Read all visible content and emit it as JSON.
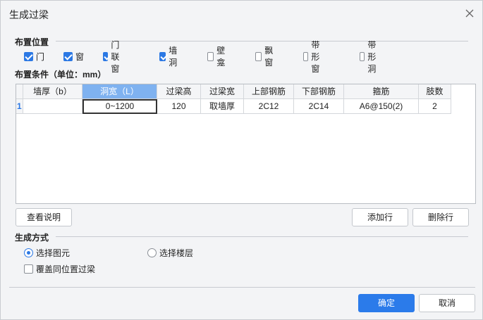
{
  "window": {
    "title": "生成过梁"
  },
  "placement": {
    "label": "布置位置",
    "options": [
      {
        "label": "门",
        "checked": true
      },
      {
        "label": "窗",
        "checked": true
      },
      {
        "label": "门联窗",
        "checked": true
      },
      {
        "label": "墙洞",
        "checked": true
      },
      {
        "label": "壁龛",
        "checked": false
      },
      {
        "label": "飘窗",
        "checked": false
      },
      {
        "label": "带形窗",
        "checked": false
      },
      {
        "label": "带形洞",
        "checked": false
      }
    ]
  },
  "conditions": {
    "label": "布置条件（单位：mm）",
    "columns": [
      "墙厚（b）",
      "洞宽（L）",
      "过梁高",
      "过梁宽",
      "上部钢筋",
      "下部钢筋",
      "箍筋",
      "肢数"
    ],
    "rows": [
      {
        "num": "1",
        "cells": [
          "",
          "0~1200",
          "120",
          "取墙厚",
          "2C12",
          "2C14",
          "A6@150(2)",
          "2"
        ]
      }
    ]
  },
  "buttons": {
    "view_help": "查看说明",
    "add_row": "添加行",
    "delete_row": "删除行",
    "ok": "确定",
    "cancel": "取消"
  },
  "generate": {
    "label": "生成方式",
    "select_element": "选择图元",
    "select_floor": "选择楼层",
    "selected": "select_element",
    "overwrite_label": "覆盖同位置过梁",
    "overwrite_checked": false
  },
  "colors": {
    "accent": "#2b7bea",
    "header_active": "#7fb2f0"
  }
}
